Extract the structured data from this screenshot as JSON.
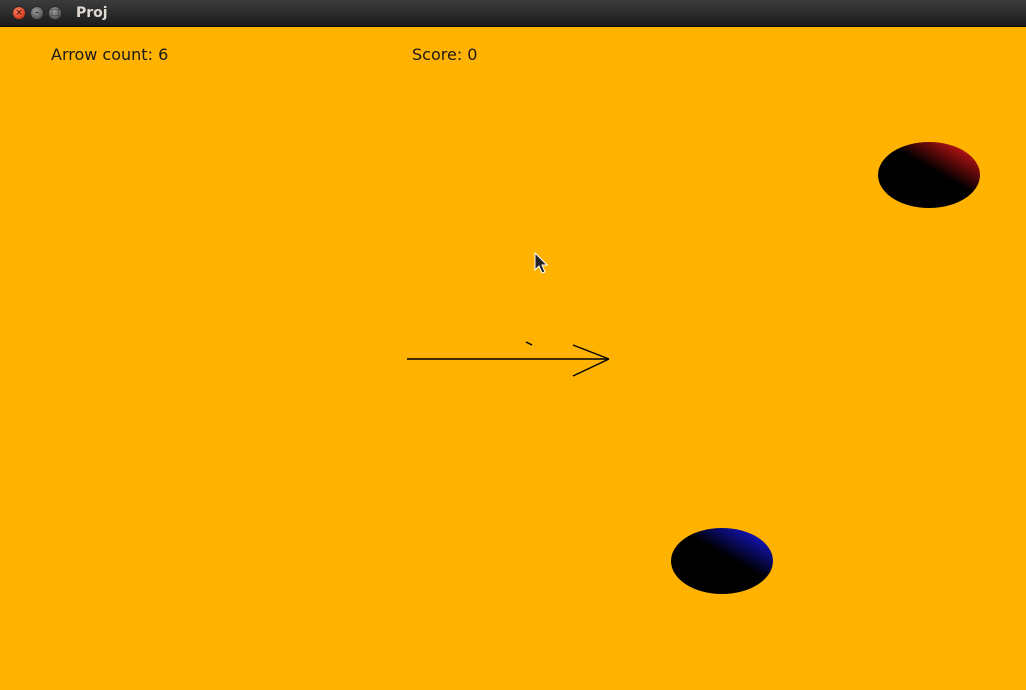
{
  "window": {
    "title": "Proj",
    "close_glyph": "×",
    "minimize_glyph": "–",
    "maximize_glyph": "□"
  },
  "game": {
    "background_color": "#ffb200",
    "hud": {
      "arrow_count_label": "Arrow count:",
      "arrow_count": 6,
      "score_label": "Score:",
      "score": 0
    },
    "balloons": [
      {
        "name": "red-balloon",
        "color": "#ff1a1a"
      },
      {
        "name": "blue-balloon",
        "color": "#1a1aff"
      }
    ],
    "arrow": {
      "color": "#000000"
    },
    "cursor_icon": "mouse-pointer-icon"
  }
}
